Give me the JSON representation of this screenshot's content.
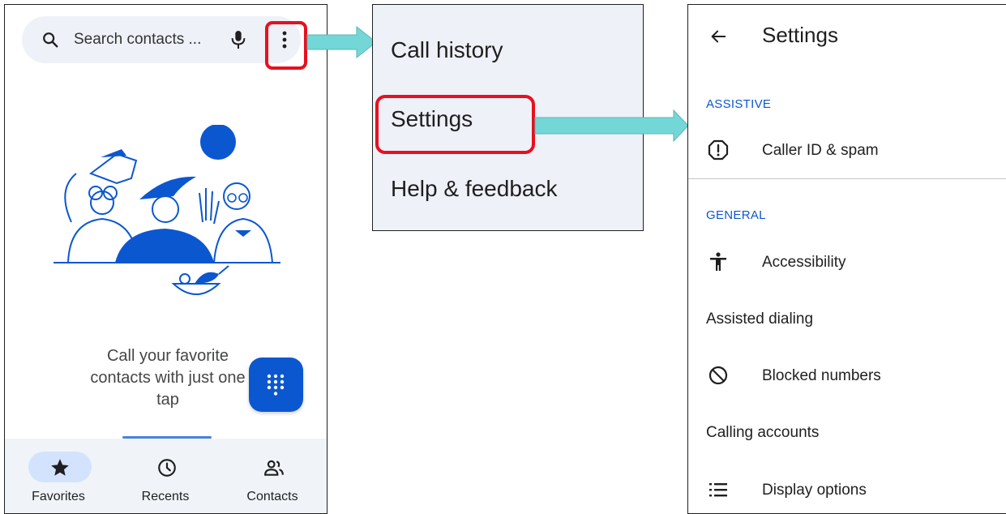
{
  "favorites_screen": {
    "search": {
      "placeholder": "Search contacts ..."
    },
    "empty_state": {
      "message": "Call your favorite contacts with just one tap"
    },
    "bottom_nav": [
      {
        "label": "Favorites",
        "icon": "star-icon",
        "active": true
      },
      {
        "label": "Recents",
        "icon": "clock-icon",
        "active": false
      },
      {
        "label": "Contacts",
        "icon": "people-icon",
        "active": false
      }
    ]
  },
  "overflow_menu": {
    "items": [
      {
        "label": "Call history"
      },
      {
        "label": "Settings",
        "highlighted": true
      },
      {
        "label": "Help & feedback"
      }
    ]
  },
  "settings_screen": {
    "title": "Settings",
    "sections": [
      {
        "header": "ASSISTIVE"
      },
      {
        "header": "GENERAL"
      }
    ],
    "items": [
      {
        "label": "Caller ID & spam",
        "icon": "alert-circle-icon"
      },
      {
        "label": "Accessibility",
        "icon": "accessibility-icon"
      },
      {
        "label": "Assisted dialing",
        "icon": ""
      },
      {
        "label": "Blocked numbers",
        "icon": "block-icon"
      },
      {
        "label": "Calling accounts",
        "icon": ""
      },
      {
        "label": "Display options",
        "icon": "list-icon"
      }
    ]
  },
  "colors": {
    "accent": "#0b57d0",
    "highlight_border": "#e8101e",
    "arrow_fill": "#74d7d7",
    "surface": "#eef1f8"
  }
}
